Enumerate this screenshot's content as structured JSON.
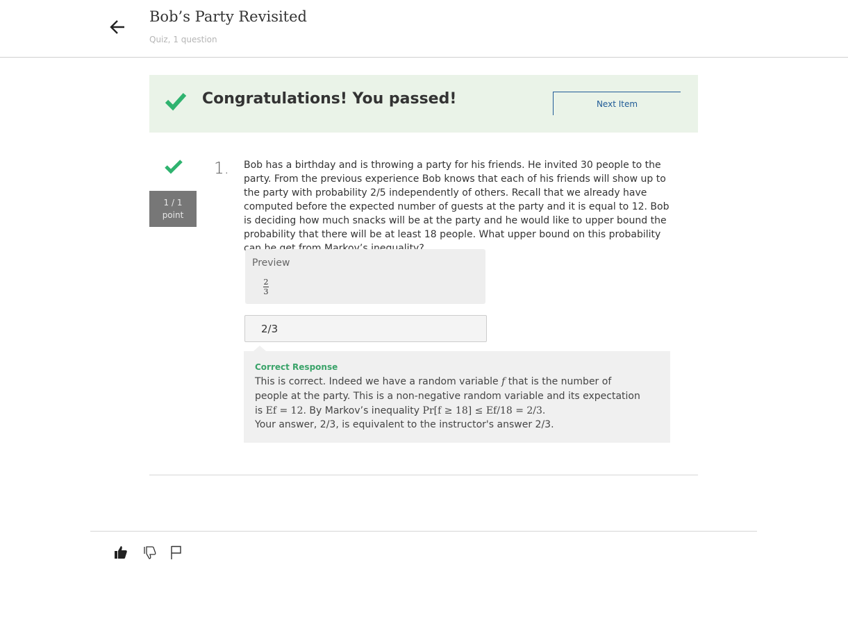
{
  "header": {
    "title": "Bob’s Party Revisited",
    "subtitle": "Quiz, 1 question"
  },
  "banner": {
    "message": "Congratulations! You passed!",
    "next_label": "Next Item"
  },
  "question": {
    "number": "1.",
    "score_line1": "1 / 1",
    "score_line2": "point",
    "text": "Bob has a birthday and is throwing a party for his friends. He invited 30 people to the party. From the previous experience Bob knows that each of his friends will show up to the party with probability 2/5 independently of others. Recall that we already have computed before the expected number of guests at the party and it is equal to 12. Bob is deciding how much snacks will be at the party and he would like to upper bound the probability that there will be at least 18 people. What upper bound on this probability can he get from Markov’s inequality?"
  },
  "preview": {
    "label": "Preview",
    "numerator": "2",
    "denominator": "3"
  },
  "answer": {
    "value": "2/3"
  },
  "feedback": {
    "title": "Correct Response",
    "text_p1": "This is correct. Indeed we have a random variable ",
    "var_f": "f",
    "text_p2": " that is the number of people at the party. This is a non-negative random variable and its expectation is ",
    "math_expect": "Ef = 12",
    "text_p3": ". By Markov’s inequality ",
    "math_markov": "Pr[f ≥ 18] ≤ Ef/18 = 2/3",
    "text_p4": ".",
    "answer_note": "Your answer, 2/3, is equivalent to the instructor's answer 2/3."
  },
  "colors": {
    "accent_green": "#3aa369",
    "check_green": "#2fb36f",
    "banner_bg": "#eaf3e8",
    "link_blue": "#1f5a96",
    "score_bg": "#777777"
  },
  "icons": {
    "back": "arrow-left-icon",
    "check": "checkmark-icon",
    "like": "thumbs-up-icon",
    "dislike": "thumbs-down-icon",
    "flag": "flag-icon"
  }
}
